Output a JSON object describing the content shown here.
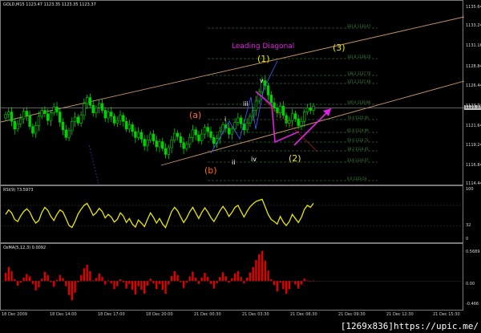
{
  "window": {
    "title": "GOLD,M15  1123.47 1123.35 1123.35 1123.37"
  },
  "colors": {
    "bg": "#000000",
    "bull": "#00d400",
    "bear": "#00d400",
    "channel": "#c8986a",
    "fib": "#2f5f2f",
    "magenta": "#e020e0",
    "yellow": "#e8e800",
    "red": "#e00000",
    "orange": "#ff6a1a",
    "price_line": "#9a9a9a"
  },
  "annotations": {
    "leading_diagonal": "Leading Diagonal",
    "wave1": "(1)",
    "wave2": "(2)",
    "wave3": "(3)",
    "wave_a": "(a)",
    "wave_b": "(b)",
    "sub_i": "i",
    "sub_ii": "ii",
    "sub_iii": "iii",
    "sub_iv": "iv",
    "sub_v": "v"
  },
  "fib_labels": [
    "261.8  1130.47",
    "161.8  1128.25",
    "138.2  1127.70",
    "127.2  1127.46",
    "100.0  1126.80",
    "76.4  1125.40",
    "61.8  1124.99",
    "50.0  1124.72",
    "38.2  1124.41",
    "23.6  1124.07",
    "0.0  1123.54"
  ],
  "rsi": {
    "title": "RSI(9) 73.5973",
    "scale_top": "100",
    "scale_mid": "32",
    "scale_bot": "0"
  },
  "osma": {
    "title": "OsMA(5,12,3) 0.0092",
    "scale_top": "0.5689",
    "scale_mid": "0.00",
    "scale_bot": "-0.466"
  },
  "price_axis": [
    "1135.64",
    "1133.24",
    "1131.16",
    "1128.84",
    "1126.44",
    "1124.04",
    "1121.64",
    "1119.24",
    "1116.84",
    "1114.44"
  ],
  "current_price": "1123.37",
  "time_axis": [
    "18 Dec 2009",
    "18 Dec 14:00",
    "18 Dec 17:00",
    "18 Dec 20:00",
    "21 Dec 00:30",
    "21 Dec 03:30",
    "21 Dec 06:30",
    "21 Dec 09:30",
    "21 Dec 12:30",
    "21 Dec 15:30"
  ],
  "watermark": "[1269x836]https://upic.me/",
  "chart_data": [
    {
      "type": "candlestick",
      "title": "GOLD,M15",
      "ylim": [
        1114.44,
        1135.64
      ],
      "close": [
        1122.6,
        1122.9,
        1121.8,
        1120.9,
        1121.5,
        1122.1,
        1123.0,
        1122.5,
        1121.2,
        1120.4,
        1121.3,
        1122.4,
        1123.1,
        1122.7,
        1121.9,
        1122.8,
        1123.5,
        1122.9,
        1121.7,
        1120.8,
        1119.9,
        1120.7,
        1121.8,
        1122.3,
        1121.6,
        1122.5,
        1123.9,
        1124.6,
        1123.7,
        1122.8,
        1123.4,
        1123.9,
        1123.1,
        1122.2,
        1122.9,
        1122.4,
        1121.6,
        1121.9,
        1122.5,
        1121.8,
        1120.9,
        1121.4,
        1120.6,
        1119.9,
        1120.5,
        1119.7,
        1118.9,
        1119.6,
        1120.3,
        1119.5,
        1118.8,
        1119.4,
        1118.6,
        1117.9,
        1118.7,
        1119.6,
        1120.4,
        1120.0,
        1119.3,
        1118.6,
        1119.1,
        1119.9,
        1120.8,
        1120.2,
        1119.5,
        1120.3,
        1121.1,
        1120.6,
        1119.9,
        1119.2,
        1119.8,
        1120.6,
        1121.4,
        1121.0,
        1120.3,
        1120.9,
        1121.7,
        1122.2,
        1121.5,
        1120.8,
        1121.6,
        1122.4,
        1123.1,
        1124.2,
        1125.3,
        1126.6,
        1126.0,
        1124.9,
        1124.0,
        1123.4,
        1122.8,
        1123.6,
        1122.5,
        1121.6,
        1121.9,
        1122.7,
        1122.1,
        1121.3,
        1121.8,
        1122.9,
        1123.4,
        1123.1,
        1123.6
      ],
      "current": 1123.37
    },
    {
      "type": "line",
      "title": "RSI(9) 73.5973",
      "ylim": [
        0,
        100
      ],
      "values": [
        52,
        61,
        55,
        42,
        38,
        49,
        58,
        63,
        57,
        44,
        35,
        40,
        56,
        66,
        60,
        48,
        40,
        52,
        61,
        57,
        44,
        30,
        26,
        38,
        53,
        62,
        70,
        74,
        63,
        50,
        55,
        64,
        58,
        45,
        52,
        47,
        37,
        42,
        55,
        49,
        36,
        44,
        33,
        27,
        41,
        35,
        28,
        42,
        55,
        46,
        35,
        44,
        33,
        26,
        42,
        58,
        66,
        59,
        47,
        36,
        45,
        57,
        66,
        55,
        44,
        56,
        65,
        57,
        46,
        38,
        48,
        59,
        68,
        60,
        48,
        56,
        66,
        70,
        58,
        47,
        58,
        67,
        73,
        78,
        80,
        82,
        67,
        52,
        42,
        38,
        33,
        48,
        37,
        30,
        38,
        52,
        44,
        36,
        46,
        62,
        70,
        66,
        74
      ]
    },
    {
      "type": "bar",
      "title": "OsMA(5,12,3) 0.0092",
      "ylim": [
        -0.466,
        0.5689
      ],
      "values": [
        0.14,
        0.24,
        0.17,
        0.03,
        -0.08,
        -0.03,
        0.06,
        0.12,
        0.08,
        -0.05,
        -0.16,
        -0.11,
        0.04,
        0.16,
        0.1,
        -0.02,
        -0.1,
        0.02,
        0.1,
        0.05,
        -0.09,
        -0.24,
        -0.33,
        -0.2,
        -0.02,
        0.1,
        0.22,
        0.28,
        0.17,
        0.01,
        0.05,
        0.13,
        0.07,
        -0.06,
        0.01,
        -0.04,
        -0.14,
        -0.09,
        0.03,
        -0.02,
        -0.13,
        -0.05,
        -0.15,
        -0.23,
        -0.09,
        -0.15,
        -0.22,
        -0.08,
        0.04,
        -0.04,
        -0.14,
        -0.05,
        -0.15,
        -0.22,
        -0.06,
        0.09,
        0.17,
        0.1,
        -0.02,
        -0.12,
        -0.03,
        0.08,
        0.16,
        0.06,
        -0.05,
        0.06,
        0.14,
        0.07,
        -0.05,
        -0.13,
        -0.04,
        0.07,
        0.15,
        0.08,
        -0.03,
        0.05,
        0.13,
        0.17,
        0.07,
        -0.04,
        0.06,
        0.15,
        0.24,
        0.36,
        0.46,
        0.52,
        0.35,
        0.18,
        0.03,
        -0.07,
        -0.18,
        -0.03,
        -0.14,
        -0.22,
        -0.14,
        0.0,
        -0.06,
        -0.13,
        -0.06,
        0.04,
        0.01,
        0.0,
        0.0092
      ]
    }
  ]
}
